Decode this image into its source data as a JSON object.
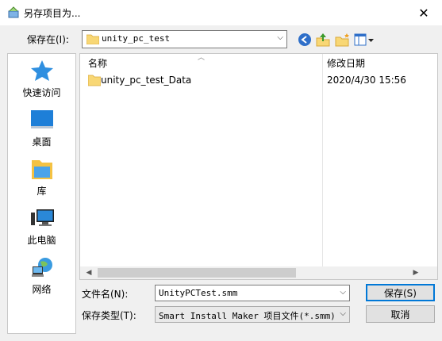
{
  "window": {
    "title": "另存项目为...",
    "close_glyph": "✕"
  },
  "toolbar": {
    "save_in_label": "保存在(I):",
    "save_in_value": "unity_pc_test",
    "icons": [
      "back-icon",
      "up-folder-icon",
      "new-folder-icon",
      "view-menu-icon"
    ]
  },
  "places": [
    {
      "label": "快速访问",
      "icon": "quick-access-star-icon"
    },
    {
      "label": "桌面",
      "icon": "desktop-icon"
    },
    {
      "label": "库",
      "icon": "library-icon"
    },
    {
      "label": "此电脑",
      "icon": "this-pc-icon"
    },
    {
      "label": "网络",
      "icon": "network-icon"
    }
  ],
  "filelist": {
    "columns": [
      "名称",
      "修改日期"
    ],
    "rows": [
      {
        "name": "unity_pc_test_Data",
        "modified": "2020/4/30 15:56",
        "icon": "folder-icon"
      }
    ]
  },
  "form": {
    "filename_label": "文件名(N):",
    "filename_value": "UnityPCTest.smm",
    "filetype_label": "保存类型(T):",
    "filetype_value": "Smart Install Maker 项目文件(*.smm)"
  },
  "buttons": {
    "save": "保存(S)",
    "cancel": "取消"
  },
  "colors": {
    "accent": "#0078d7",
    "folder": "#f8d775"
  }
}
